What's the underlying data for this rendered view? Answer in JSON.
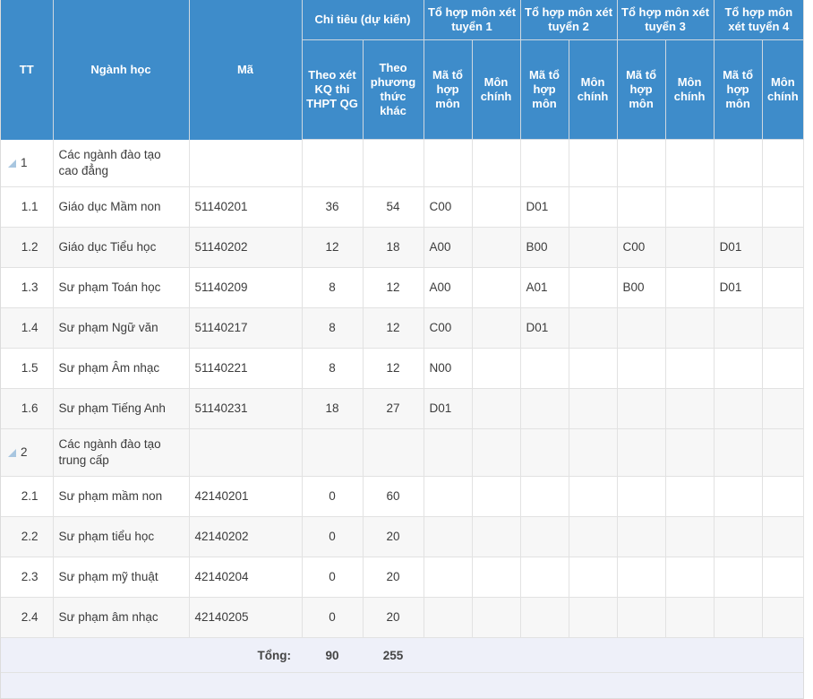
{
  "table": {
    "header": {
      "tt": "TT",
      "nganh_hoc": "Ngành học",
      "ma": "Mã",
      "chi_tieu": "Chỉ tiêu (dự kiến)",
      "theo_xet_kq": "Theo xét KQ thi THPT QG",
      "theo_phuong_thuc_khac": "Theo phương thức khác",
      "to_hop_1": "Tổ hợp môn xét tuyển 1",
      "to_hop_2": "Tổ hợp môn xét tuyển 2",
      "to_hop_3": "Tổ hợp môn xét tuyển 3",
      "to_hop_4": "Tổ hợp môn xét tuyển 4",
      "ma_to_hop_mon": "Mã tổ hợp môn",
      "mon_chinh": "Môn chính"
    },
    "rows": [
      {
        "type": "group",
        "tt": "1",
        "nganh_hoc": "Các ngành đào tạo cao đẳng",
        "ma": "",
        "theo_xet_kq": "",
        "theo_phuong_thuc_khac": "",
        "ma1": "",
        "mc1": "",
        "ma2": "",
        "mc2": "",
        "ma3": "",
        "mc3": "",
        "ma4": "",
        "mc4": ""
      },
      {
        "type": "data",
        "tt": "1.1",
        "nganh_hoc": "Giáo dục Mầm non",
        "ma": "51140201",
        "theo_xet_kq": "36",
        "theo_phuong_thuc_khac": "54",
        "ma1": "C00",
        "mc1": "",
        "ma2": "D01",
        "mc2": "",
        "ma3": "",
        "mc3": "",
        "ma4": "",
        "mc4": ""
      },
      {
        "type": "data",
        "tt": "1.2",
        "nganh_hoc": "Giáo dục Tiểu học",
        "ma": "51140202",
        "theo_xet_kq": "12",
        "theo_phuong_thuc_khac": "18",
        "ma1": "A00",
        "mc1": "",
        "ma2": "B00",
        "mc2": "",
        "ma3": "C00",
        "mc3": "",
        "ma4": "D01",
        "mc4": ""
      },
      {
        "type": "data",
        "tt": "1.3",
        "nganh_hoc": "Sư phạm Toán học",
        "ma": "51140209",
        "theo_xet_kq": "8",
        "theo_phuong_thuc_khac": "12",
        "ma1": "A00",
        "mc1": "",
        "ma2": "A01",
        "mc2": "",
        "ma3": "B00",
        "mc3": "",
        "ma4": "D01",
        "mc4": ""
      },
      {
        "type": "data",
        "tt": "1.4",
        "nganh_hoc": "Sư phạm Ngữ văn",
        "ma": "51140217",
        "theo_xet_kq": "8",
        "theo_phuong_thuc_khac": "12",
        "ma1": "C00",
        "mc1": "",
        "ma2": "D01",
        "mc2": "",
        "ma3": "",
        "mc3": "",
        "ma4": "",
        "mc4": ""
      },
      {
        "type": "data",
        "tt": "1.5",
        "nganh_hoc": "Sư phạm Âm nhạc",
        "ma": "51140221",
        "theo_xet_kq": "8",
        "theo_phuong_thuc_khac": "12",
        "ma1": "N00",
        "mc1": "",
        "ma2": "",
        "mc2": "",
        "ma3": "",
        "mc3": "",
        "ma4": "",
        "mc4": ""
      },
      {
        "type": "data",
        "tt": "1.6",
        "nganh_hoc": "Sư phạm Tiếng Anh",
        "ma": "51140231",
        "theo_xet_kq": "18",
        "theo_phuong_thuc_khac": "27",
        "ma1": "D01",
        "mc1": "",
        "ma2": "",
        "mc2": "",
        "ma3": "",
        "mc3": "",
        "ma4": "",
        "mc4": ""
      },
      {
        "type": "group",
        "tt": "2",
        "nganh_hoc": "Các ngành đào tạo trung cấp",
        "ma": "",
        "theo_xet_kq": "",
        "theo_phuong_thuc_khac": "",
        "ma1": "",
        "mc1": "",
        "ma2": "",
        "mc2": "",
        "ma3": "",
        "mc3": "",
        "ma4": "",
        "mc4": ""
      },
      {
        "type": "data",
        "tt": "2.1",
        "nganh_hoc": "Sư phạm mầm non",
        "ma": "42140201",
        "theo_xet_kq": "0",
        "theo_phuong_thuc_khac": "60",
        "ma1": "",
        "mc1": "",
        "ma2": "",
        "mc2": "",
        "ma3": "",
        "mc3": "",
        "ma4": "",
        "mc4": ""
      },
      {
        "type": "data",
        "tt": "2.2",
        "nganh_hoc": "Sư phạm tiểu học",
        "ma": "42140202",
        "theo_xet_kq": "0",
        "theo_phuong_thuc_khac": "20",
        "ma1": "",
        "mc1": "",
        "ma2": "",
        "mc2": "",
        "ma3": "",
        "mc3": "",
        "ma4": "",
        "mc4": ""
      },
      {
        "type": "data",
        "tt": "2.3",
        "nganh_hoc": "Sư phạm mỹ thuật",
        "ma": "42140204",
        "theo_xet_kq": "0",
        "theo_phuong_thuc_khac": "20",
        "ma1": "",
        "mc1": "",
        "ma2": "",
        "mc2": "",
        "ma3": "",
        "mc3": "",
        "ma4": "",
        "mc4": ""
      },
      {
        "type": "data",
        "tt": "2.4",
        "nganh_hoc": "Sư phạm âm nhạc",
        "ma": "42140205",
        "theo_xet_kq": "0",
        "theo_phuong_thuc_khac": "20",
        "ma1": "",
        "mc1": "",
        "ma2": "",
        "mc2": "",
        "ma3": "",
        "mc3": "",
        "ma4": "",
        "mc4": ""
      }
    ],
    "footer": {
      "label": "Tổng:",
      "total_theo_xet_kq": "90",
      "total_theo_phuong_thuc_khac": "255"
    }
  },
  "colors": {
    "header_blue": "#3e8cca",
    "row_alt": "#f7f7f7",
    "footer_bg": "#eef0f9",
    "expander": "#a8c6e0"
  }
}
